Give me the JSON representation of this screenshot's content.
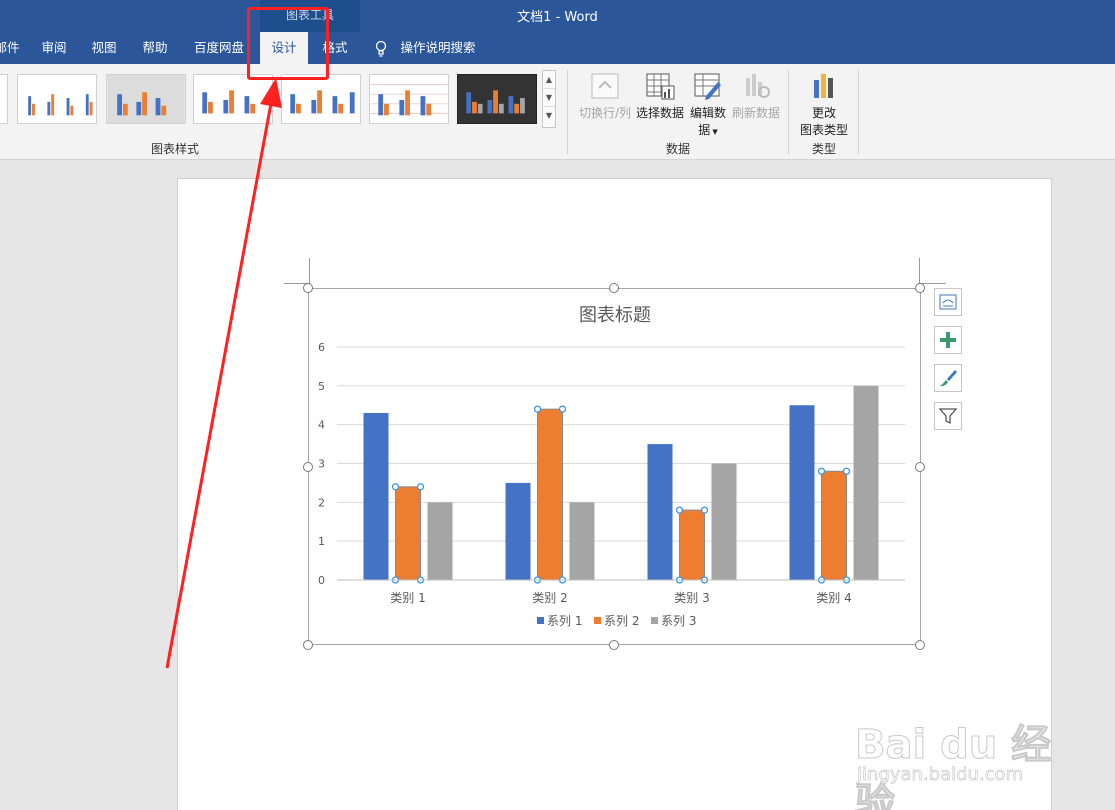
{
  "window": {
    "title": "文档1  -  Word",
    "tool_context": "图表工具"
  },
  "tabs": [
    {
      "label": "邮件"
    },
    {
      "label": "审阅"
    },
    {
      "label": "视图"
    },
    {
      "label": "帮助"
    },
    {
      "label": "百度网盘"
    },
    {
      "label": "设计",
      "active": true
    },
    {
      "label": "格式"
    }
  ],
  "tell_me": "操作说明搜索",
  "ribbon": {
    "groups": {
      "chart_styles": "图表样式",
      "data": "数据",
      "type": "类型"
    },
    "buttons": {
      "switch_row_col": "切换行/列",
      "select_data": "选择数据",
      "edit_data_line1": "编辑数",
      "edit_data_line2": "据",
      "refresh_data": "刷新数据",
      "change_type_line1": "更改",
      "change_type_line2": "图表类型"
    }
  },
  "chart_data": {
    "type": "bar",
    "title": "图表标题",
    "categories": [
      "类别 1",
      "类别 2",
      "类别 3",
      "类别 4"
    ],
    "series": [
      {
        "name": "系列 1",
        "values": [
          4.3,
          2.5,
          3.5,
          4.5
        ],
        "color": "#4472c4"
      },
      {
        "name": "系列 2",
        "values": [
          2.4,
          4.4,
          1.8,
          2.8
        ],
        "color": "#ed7d31"
      },
      {
        "name": "系列 3",
        "values": [
          2,
          2,
          3,
          5
        ],
        "color": "#a5a5a5"
      }
    ],
    "yticks": [
      "0",
      "1",
      "2",
      "3",
      "4",
      "5",
      "6"
    ],
    "ylim": [
      0,
      6
    ],
    "grid": true,
    "legend": "bottom",
    "selected_series": "系列 2"
  },
  "watermark": {
    "brand": "Bai du 经验",
    "url": "jingyan.baidu.com"
  },
  "colors": {
    "accent": "#2b579a",
    "annotation": "#ff2020"
  }
}
